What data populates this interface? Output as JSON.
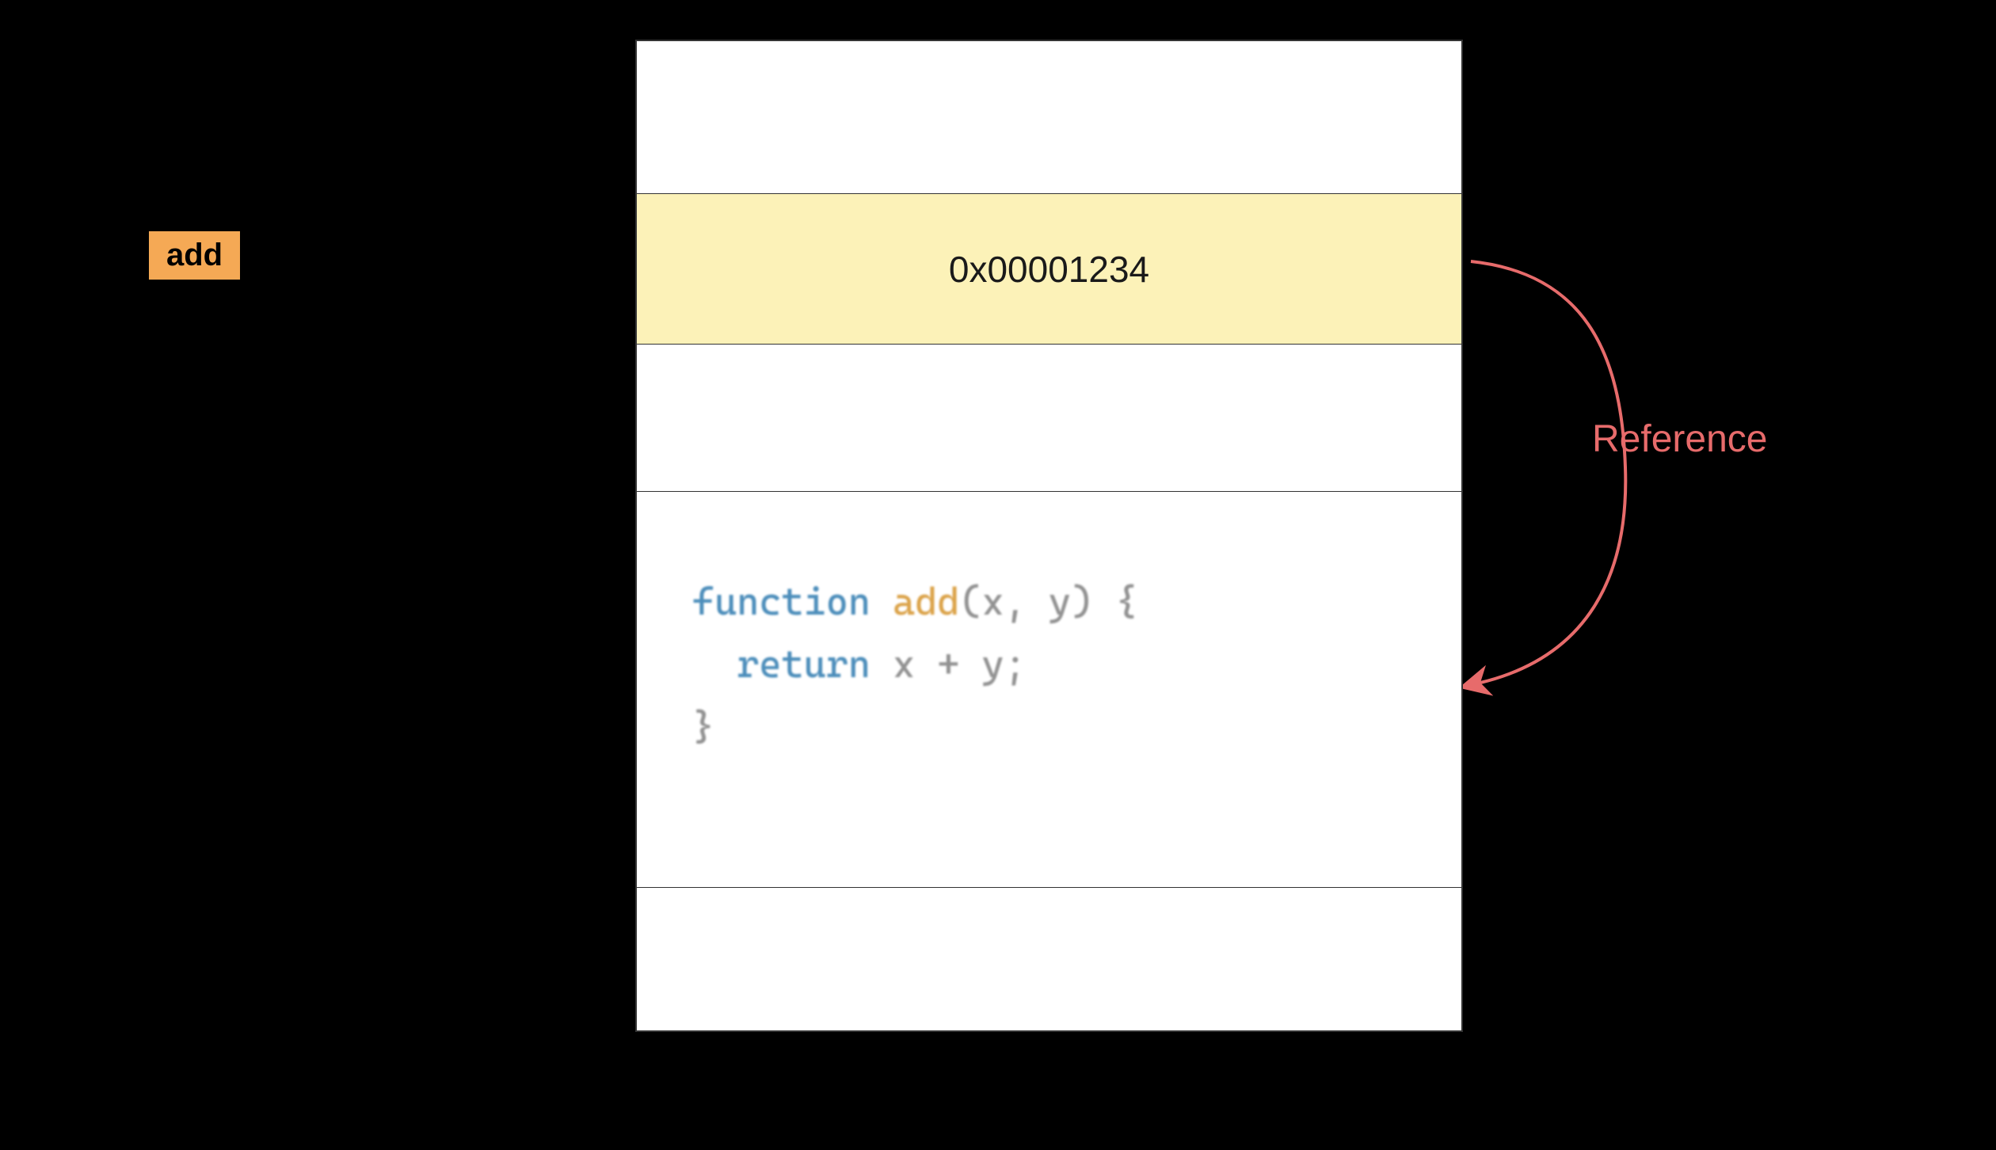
{
  "variable": {
    "name": "add"
  },
  "memory": {
    "address": "0x00001234",
    "code": {
      "keyword_function": "function",
      "func_name": "add",
      "params": "(x, y) {",
      "keyword_return": "return",
      "body": " x + y;",
      "close": "}"
    }
  },
  "annotation": {
    "label": "Reference"
  },
  "colors": {
    "badge_bg": "#f5a955",
    "address_bg": "#fcf2b8",
    "arrow": "#e76b6b",
    "keyword": "#3d84b5",
    "function_name": "#d89b3a"
  }
}
